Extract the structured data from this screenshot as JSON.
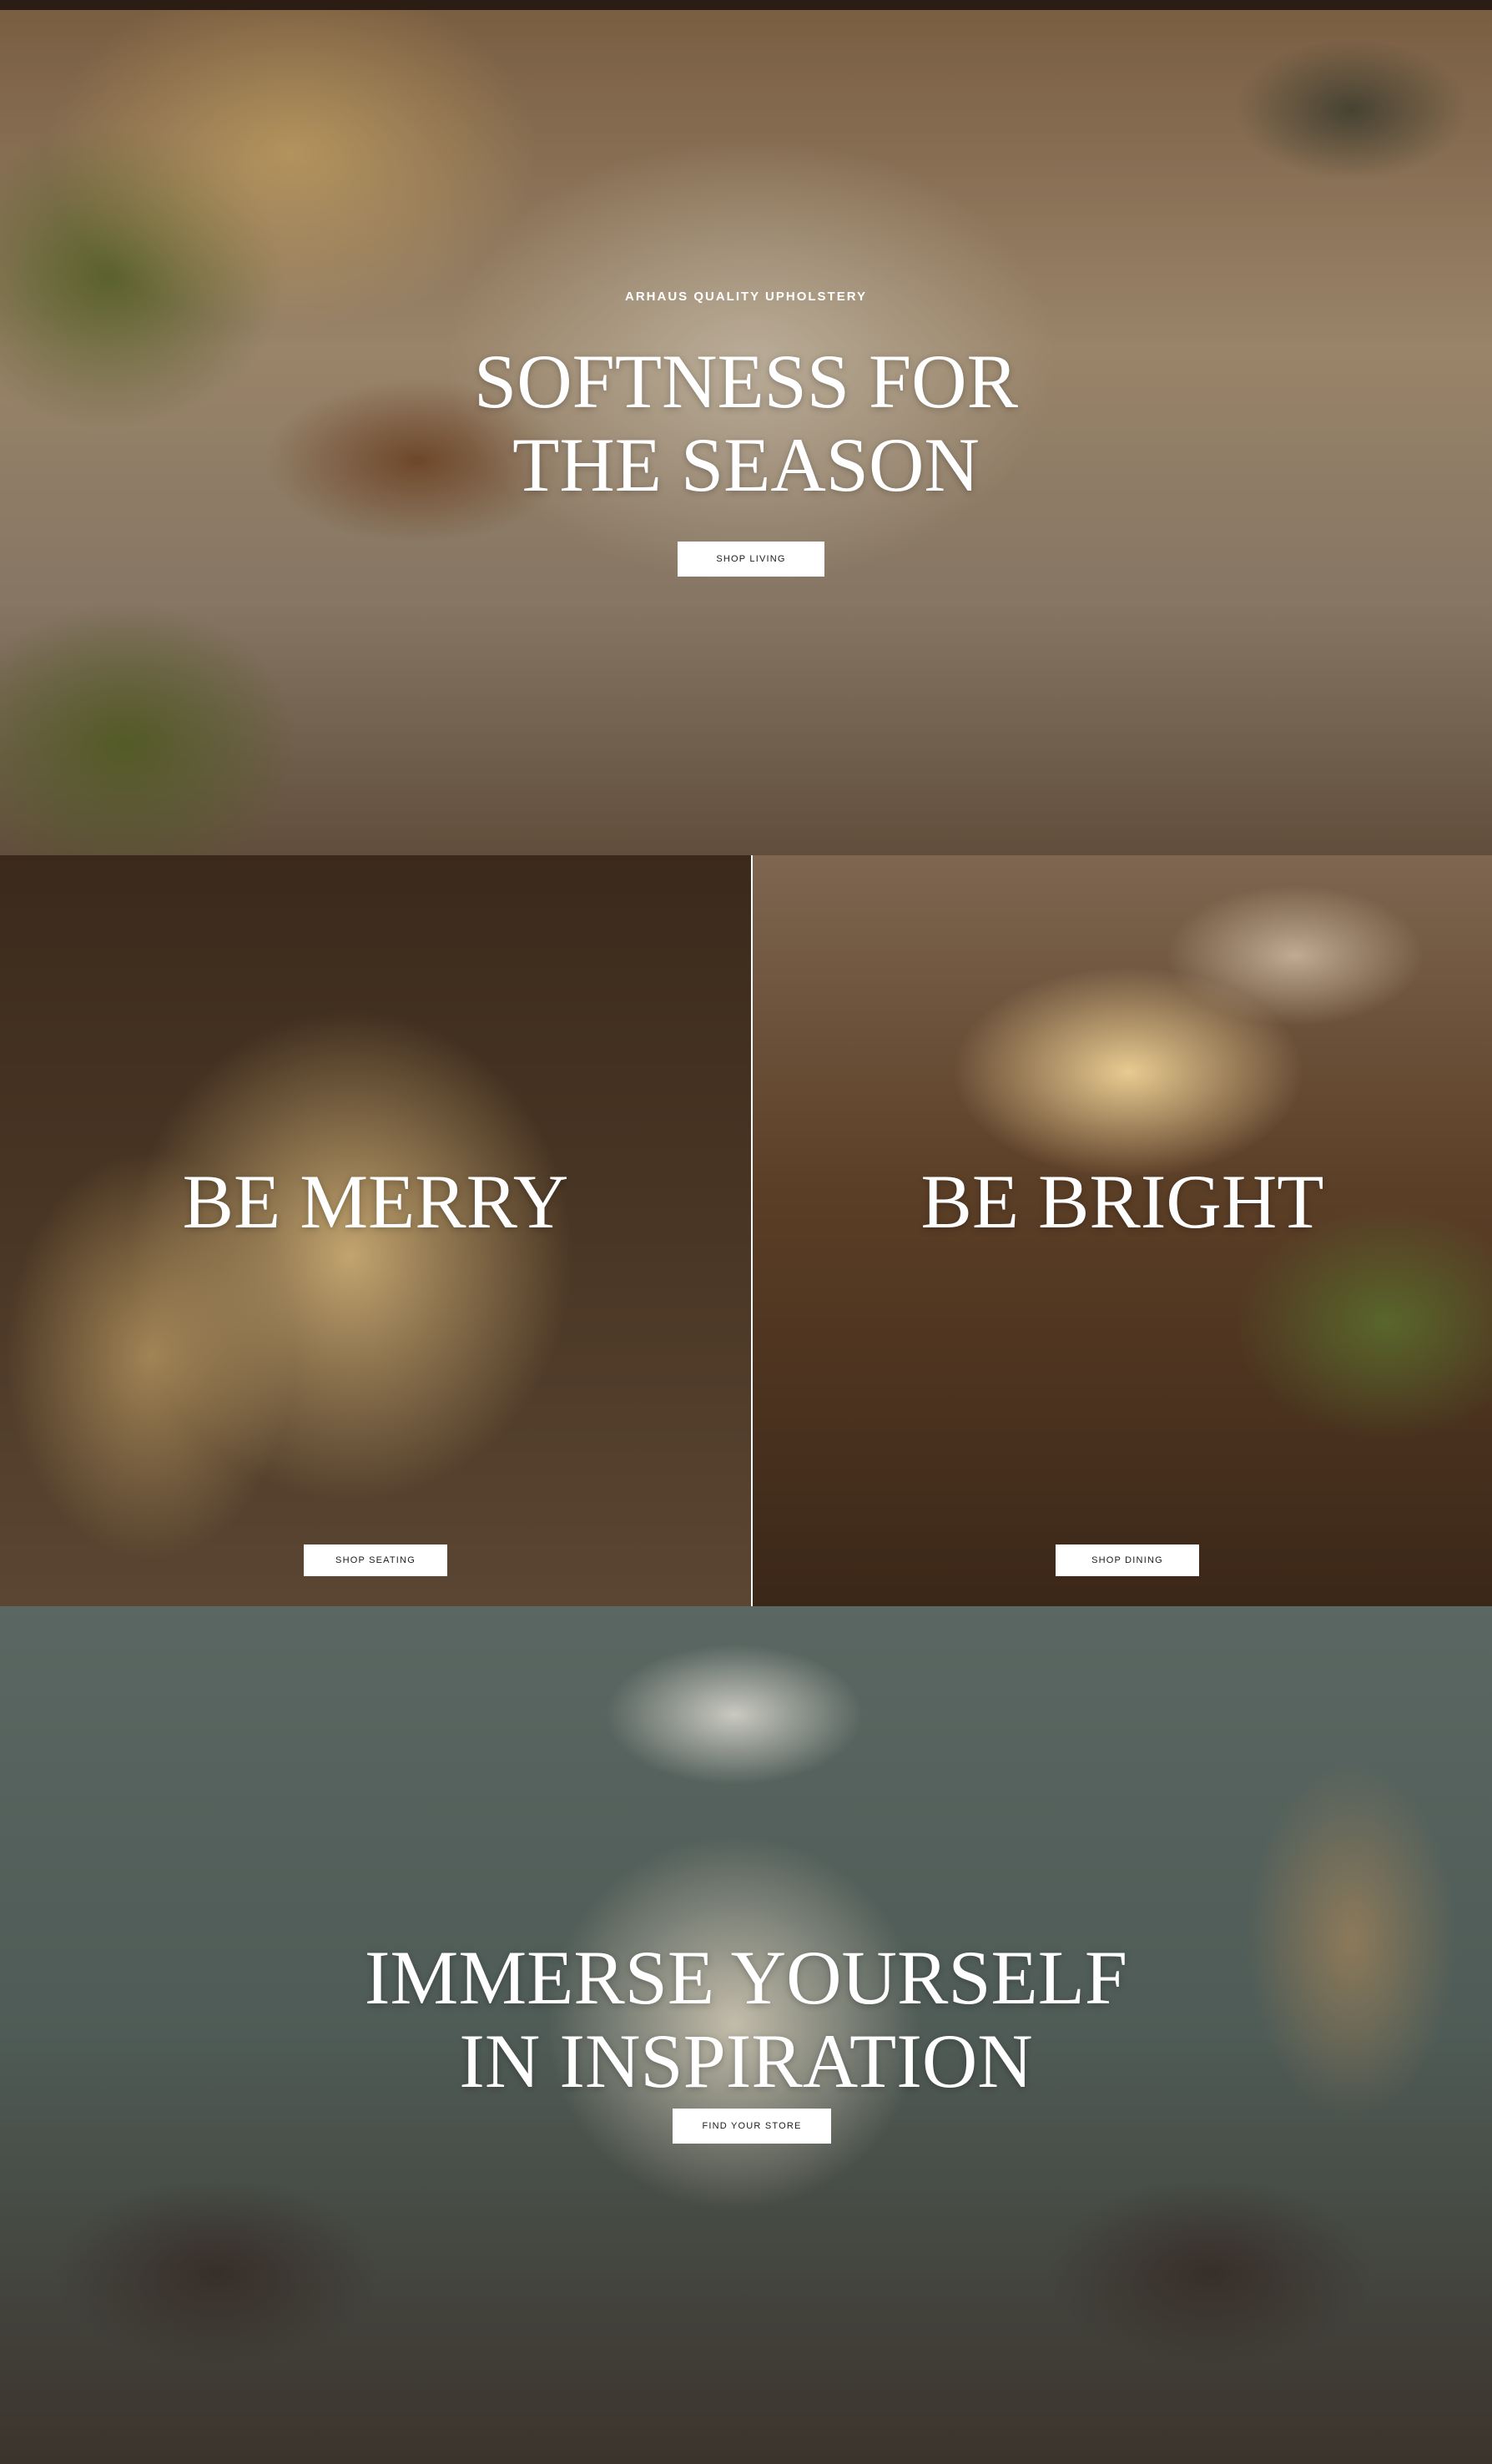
{
  "hero": {
    "eyebrow": "ARHAUS QUALITY UPHOLSTERY",
    "title_line1": "SOFTNESS FOR",
    "title_line2": "THE SEASON",
    "button": "SHOP LIVING"
  },
  "tiles": [
    {
      "title": "BE MERRY",
      "button": "SHOP SEATING"
    },
    {
      "title": "BE BRIGHT",
      "button": "SHOP DINING"
    }
  ],
  "inspiration": {
    "title_line1": "IMMERSE YOURSELF",
    "title_line2": "IN INSPIRATION",
    "button": "FIND YOUR STORE"
  }
}
